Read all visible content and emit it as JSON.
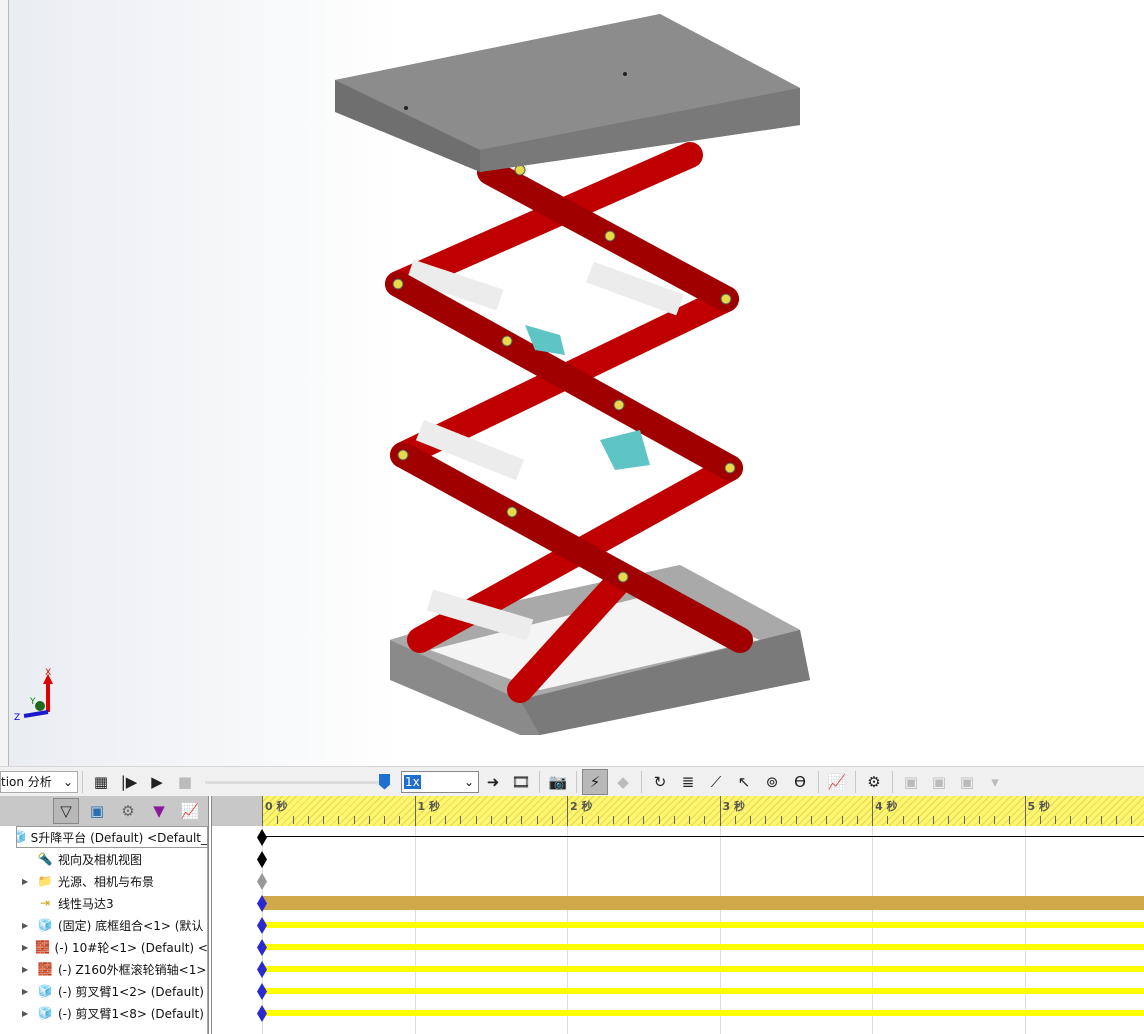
{
  "toolbar": {
    "study_selector": "tion 分析",
    "speed": "1x",
    "icons": [
      "calculate-icon",
      "play-from-start-icon",
      "play-icon",
      "stop-icon",
      "playback-mode-icon",
      "save-animation-icon",
      "animation-wizard-icon",
      "autokey-icon",
      "add-key-icon",
      "motor-icon",
      "spring-icon",
      "damper-icon",
      "force-icon",
      "contact-icon",
      "gravity-icon",
      "results-plots-icon",
      "motion-study-properties-icon",
      "collapse-icon"
    ]
  },
  "tree": {
    "filters": [
      "filter-animation-icon",
      "filter-driving-icon",
      "filter-selected-icon",
      "filter-results-icon",
      "filter-plots-icon"
    ],
    "items": [
      {
        "label": "S升降平台 (Default) <Default_",
        "icon": "assembly-icon",
        "expand": "▼"
      },
      {
        "label": "视向及相机视图",
        "icon": "camera-view-icon",
        "expand": ""
      },
      {
        "label": "光源、相机与布景",
        "icon": "lights-folder-icon",
        "expand": "▶"
      },
      {
        "label": "线性马达3",
        "icon": "linear-motor-icon",
        "expand": ""
      },
      {
        "label": "(固定) 底框组合<1> (默认",
        "icon": "assembly-icon",
        "expand": "▶"
      },
      {
        "label": "(-) 10#轮<1> (Default) <",
        "icon": "part-icon",
        "expand": "▶"
      },
      {
        "label": "(-) Z160外框滚轮销轴<1>",
        "icon": "part-icon",
        "expand": "▶"
      },
      {
        "label": "(-) 剪叉臂1<2> (Default)",
        "icon": "assembly-icon",
        "expand": "▶"
      },
      {
        "label": "(-) 剪叉臂1<8> (Default)",
        "icon": "assembly-icon",
        "expand": "▶"
      }
    ]
  },
  "timeline": {
    "seconds": [
      "0 秒",
      "1 秒",
      "2 秒",
      "3 秒",
      "4 秒",
      "5 秒"
    ],
    "colors": {
      "motor_bar": "#cfa94a",
      "component_bar": "#ffff00",
      "key": "#2a2ad0",
      "ruler": "#fff66e"
    }
  },
  "triad": {
    "x": "X",
    "y": "Y",
    "z": "Z"
  }
}
